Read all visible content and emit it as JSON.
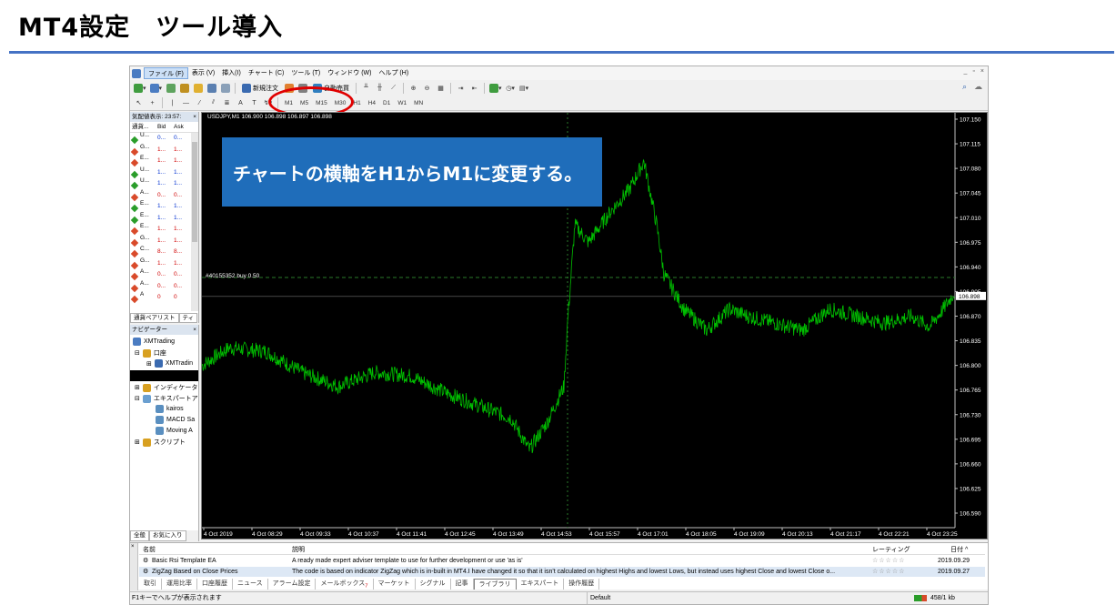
{
  "slide": {
    "title": "MT4設定　ツール導入"
  },
  "menu": [
    "ファイル (F)",
    "表示 (V)",
    "挿入(I)",
    "チャート (C)",
    "ツール (T)",
    "ウィンドウ (W)",
    "ヘルプ (H)"
  ],
  "win_ctrls": [
    "_",
    "▫",
    "×"
  ],
  "toolbar": {
    "new_order": "新規注文",
    "auto_trade": "自動売買"
  },
  "timeframes": [
    "M1",
    "M5",
    "M15",
    "M30",
    "H1",
    "H4",
    "D1",
    "W1",
    "MN"
  ],
  "market_watch": {
    "title": "気配値表示: 23:57:",
    "headers": [
      "通貨...",
      "Bid",
      "Ask"
    ],
    "rows": [
      {
        "sym": "U...",
        "bid": "0...",
        "ask": "0...",
        "dir": "g",
        "color": "blue"
      },
      {
        "sym": "G...",
        "bid": "1...",
        "ask": "1...",
        "dir": "r",
        "color": "red"
      },
      {
        "sym": "E...",
        "bid": "1...",
        "ask": "1...",
        "dir": "r",
        "color": "red"
      },
      {
        "sym": "U...",
        "bid": "1...",
        "ask": "1...",
        "dir": "g",
        "color": "blue"
      },
      {
        "sym": "U...",
        "bid": "1...",
        "ask": "1...",
        "dir": "g",
        "color": "blue"
      },
      {
        "sym": "A...",
        "bid": "0...",
        "ask": "0...",
        "dir": "r",
        "color": "red"
      },
      {
        "sym": "E...",
        "bid": "1...",
        "ask": "1...",
        "dir": "g",
        "color": "blue"
      },
      {
        "sym": "E...",
        "bid": "1...",
        "ask": "1...",
        "dir": "g",
        "color": "blue"
      },
      {
        "sym": "E...",
        "bid": "1...",
        "ask": "1...",
        "dir": "r",
        "color": "red"
      },
      {
        "sym": "G...",
        "bid": "1...",
        "ask": "1...",
        "dir": "r",
        "color": "red"
      },
      {
        "sym": "C...",
        "bid": "8...",
        "ask": "8...",
        "dir": "r",
        "color": "red"
      },
      {
        "sym": "G...",
        "bid": "1...",
        "ask": "1...",
        "dir": "r",
        "color": "red"
      },
      {
        "sym": "A...",
        "bid": "0...",
        "ask": "0...",
        "dir": "r",
        "color": "red"
      },
      {
        "sym": "A...",
        "bid": "0...",
        "ask": "0...",
        "dir": "r",
        "color": "red"
      },
      {
        "sym": "A",
        "bid": "0",
        "ask": "0",
        "dir": "r",
        "color": "red"
      }
    ],
    "tabs": [
      "通貨ペアリスト",
      "ティ"
    ]
  },
  "navigator": {
    "title": "ナビゲーター",
    "root": "XMTrading",
    "accounts": "口座",
    "account_item": "XMTradin",
    "indicators": "インディケータ",
    "experts": "エキスパートアド",
    "ea_items": [
      "kairos",
      "MACD Sa",
      "Moving A"
    ],
    "scripts": "スクリプト",
    "tabs": [
      "全般",
      "お気に入り"
    ]
  },
  "chart": {
    "title": "USDJPY,M1  106.900 106.898 106.897 106.898",
    "order_label": "#40155352 buy 0.50",
    "current_price": "106.898",
    "price_labels": [
      "107.150",
      "107.115",
      "107.080",
      "107.045",
      "107.010",
      "106.975",
      "106.940",
      "106.905",
      "106.870",
      "106.835",
      "106.800",
      "106.765",
      "106.730",
      "106.695",
      "106.660",
      "106.625",
      "106.590"
    ],
    "time_labels": [
      "4 Oct 2019",
      "4 Oct 08:29",
      "4 Oct 09:33",
      "4 Oct 10:37",
      "4 Oct 11:41",
      "4 Oct 12:45",
      "4 Oct 13:49",
      "4 Oct 14:53",
      "4 Oct 15:57",
      "4 Oct 17:01",
      "4 Oct 18:05",
      "4 Oct 19:09",
      "4 Oct 20:13",
      "4 Oct 21:17",
      "4 Oct 22:21",
      "4 Oct 23:25"
    ],
    "line_color": "#00c000",
    "callout": "チャートの横軸をH1からM1に変更する。"
  },
  "terminal": {
    "headers": {
      "name": "名前",
      "desc": "説明",
      "rating": "レーティング",
      "date": "日付 ^"
    },
    "rows": [
      {
        "name": "Basic Rsi Template EA",
        "desc": "A ready made expert adviser template to use for further development or use 'as is'",
        "date": "2019.09.29"
      },
      {
        "name": "ZigZag Based on Close Prices",
        "desc": "The code is based on indicator ZigZag which is in-built in MT4.I have changed it so that it isn't calculated on highest Highs and lowest Lows, but instead uses highest Close and lowest Close o...",
        "date": "2019.09.27"
      }
    ],
    "stars": "☆☆☆☆☆",
    "tabs": [
      "取引",
      "運用比率",
      "口座履歴",
      "ニュース",
      "アラーム設定",
      "メールボックス",
      "マーケット",
      "シグナル",
      "記事",
      "ライブラリ",
      "エキスパート",
      "操作履歴"
    ],
    "mail_count": "7",
    "active_tab": "ライブラリ"
  },
  "status": {
    "help": "F1キーでヘルプが表示されます",
    "profile": "Default",
    "traffic": "458/1 kb"
  }
}
